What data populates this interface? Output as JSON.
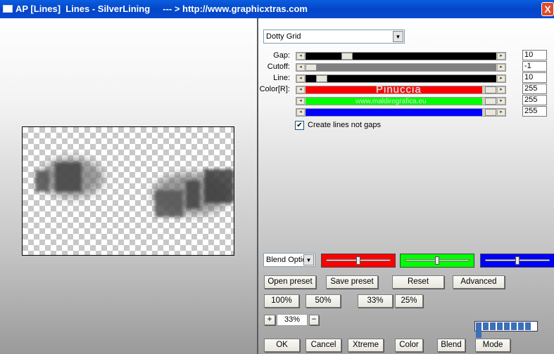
{
  "window": {
    "title": "AP [Lines]  Lines - SilverLining     --- > http://www.graphicxtras.com",
    "close_glyph": "X"
  },
  "preset_select": {
    "value": "Dotty Grid"
  },
  "sliders": [
    {
      "label": "Gap:",
      "value": "10",
      "track_color": "#000000",
      "fill": 0.2
    },
    {
      "label": "Cutoff:",
      "value": "-1",
      "track_color": "#808080",
      "fill": 0.0
    },
    {
      "label": "Line:",
      "value": "10",
      "track_color": "#000000",
      "fill": 0.06
    },
    {
      "label": "Color[R]:",
      "value": "255",
      "track_color": "#ff0000",
      "fill": 1.0
    },
    {
      "label": "",
      "value": "255",
      "track_color": "#00ff00",
      "fill": 1.0
    },
    {
      "label": "",
      "value": "255",
      "track_color": "#0000ff",
      "fill": 1.0
    }
  ],
  "watermark": {
    "line1": "Pinuccia",
    "line2": "www.maldiregrafica.eu"
  },
  "checkbox": {
    "label": "Create lines not gaps",
    "checked": true,
    "mark": "✔"
  },
  "blend_select": {
    "value": "Blend Optio"
  },
  "color_swatches": [
    {
      "color": "#ff0000",
      "level": 0.5
    },
    {
      "color": "#00ff00",
      "level": 0.5
    },
    {
      "color": "#0000ff",
      "level": 0.5
    }
  ],
  "buttons_row1": [
    "Open preset",
    "Save preset",
    "Reset",
    "Advanced"
  ],
  "zoom_buttons": [
    "100%",
    "50%",
    "33%",
    "25%"
  ],
  "zoom": {
    "plus": "+",
    "value": "33%",
    "minus": "−"
  },
  "bottom_buttons": [
    "OK",
    "Cancel",
    "Xtreme",
    "Color",
    "Blend",
    "Mode"
  ],
  "progress_segments": 9
}
